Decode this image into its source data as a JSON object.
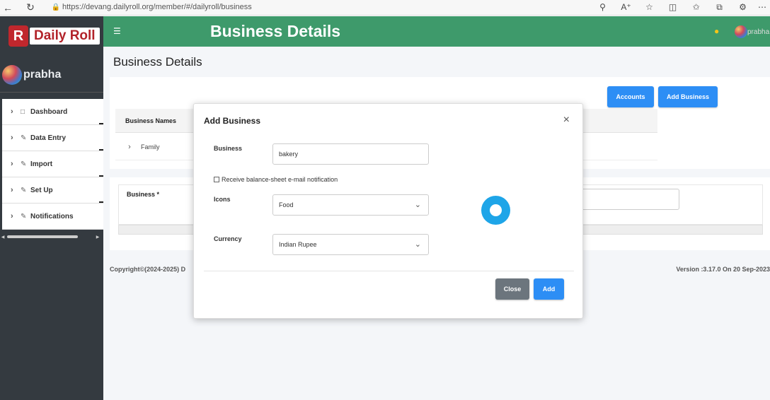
{
  "browser": {
    "url": "https://devang.dailyroll.org/member/#/dailyroll/business",
    "back_icon": "arrow-left-icon",
    "refresh_icon": "refresh-icon"
  },
  "sidebar": {
    "logo_letter": "R",
    "logo_text": "Daily Roll",
    "user_name": "prabha",
    "menu": [
      {
        "label": "Dashboard",
        "icon": "file-icon"
      },
      {
        "label": "Data Entry",
        "icon": "pencil-icon"
      },
      {
        "label": "Import",
        "icon": "pencil-icon"
      },
      {
        "label": "Set Up",
        "icon": "pencil-icon"
      },
      {
        "label": "Notifications",
        "icon": "pencil-icon"
      }
    ]
  },
  "header": {
    "title": "Business Details",
    "user_name": "prabha",
    "brand_color": "#3e9a6b"
  },
  "main": {
    "page_title": "Business Details",
    "accounts_label": "Accounts",
    "add_business_label": "Add Business",
    "table_header": "Business Names",
    "rows": [
      "Family"
    ],
    "business_label": "Business *",
    "footer_left": "Copyright©(2024-2025) D",
    "footer_right": "Version :3.17.0 On 20 Sep-2023"
  },
  "modal": {
    "title": "Add Business",
    "business_label": "Business",
    "business_value": "bakery",
    "checkbox_label": "Receive balance-sheet e-mail notification",
    "checkbox_checked": false,
    "icons_label": "Icons",
    "icons_value": "Food",
    "currency_label": "Currency",
    "currency_value": "Indian Rupee",
    "close_label": "Close",
    "add_label": "Add"
  }
}
